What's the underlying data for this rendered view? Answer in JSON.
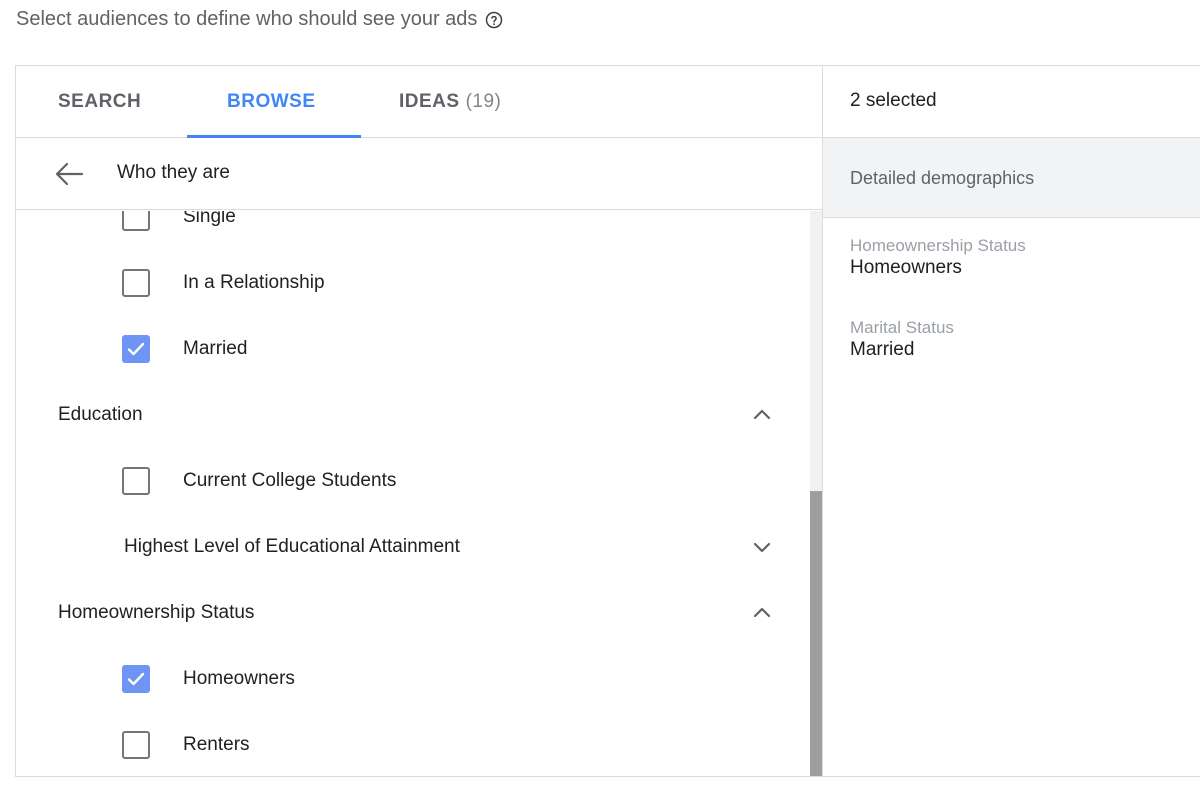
{
  "header": {
    "prompt": "Select audiences to define who should see your ads",
    "help_icon": "help-circle-icon"
  },
  "tabs": [
    {
      "label": "SEARCH",
      "count": ""
    },
    {
      "label": "BROWSE",
      "count": ""
    },
    {
      "label": "IDEAS",
      "count": "(19)"
    }
  ],
  "active_tab": "BROWSE",
  "breadcrumb": {
    "label": "Who they are"
  },
  "list": {
    "single": {
      "label": "Single",
      "checked": false
    },
    "in_relationship": {
      "label": "In a Relationship",
      "checked": false
    },
    "married": {
      "label": "Married",
      "checked": true
    },
    "education": {
      "label": "Education",
      "expanded": true
    },
    "college_students": {
      "label": "Current College Students",
      "checked": false
    },
    "highest_level": {
      "label": "Highest Level of Educational Attainment",
      "expanded": false
    },
    "homeownership": {
      "label": "Homeownership Status",
      "expanded": true
    },
    "homeowners": {
      "label": "Homeowners",
      "checked": true
    },
    "renters": {
      "label": "Renters",
      "checked": false
    }
  },
  "selection": {
    "count_label": "2 selected",
    "section_title": "Detailed demographics",
    "items": [
      {
        "category": "Homeownership Status",
        "value": "Homeowners"
      },
      {
        "category": "Marital Status",
        "value": "Married"
      }
    ]
  },
  "colors": {
    "accent": "#4285f4",
    "checkbox_checked": "#6e94f4",
    "border": "#dadce0",
    "muted": "#5f6368"
  }
}
